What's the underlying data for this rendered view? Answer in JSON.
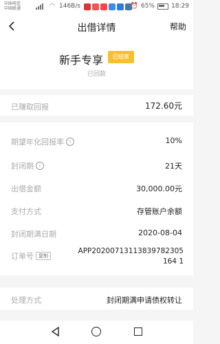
{
  "status_bar": {
    "carrier_line1": "中国电信",
    "carrier_line2": "中国联通",
    "net_speed": "146B/s",
    "battery": "65%",
    "time": "18:29"
  },
  "header": {
    "title": "出借详情",
    "help": "帮助"
  },
  "product": {
    "name": "新手专享",
    "tag": "已结束",
    "repay_status": "已回款"
  },
  "earned": {
    "label": "已赚取回报",
    "value": "172.60元"
  },
  "details": {
    "annual_rate_label": "期望年化回报率",
    "annual_rate_value": "10%",
    "lock_period_label": "封闭期",
    "lock_period_value": "21天",
    "amount_label": "出借金额",
    "amount_value": "30,000.00元",
    "payment_label": "支付方式",
    "payment_value": "存管账户余额",
    "due_date_label": "封闭期满日期",
    "due_date_value": "2020-08-04",
    "order_label": "订单号",
    "copy_label": "复制",
    "order_value": "APP20200713113839782305164 1"
  },
  "method": {
    "label": "处理方式",
    "value": "封闭期满申请债权转让"
  },
  "colors": {
    "tag_bg": "#f6c12d",
    "label": "#aaaaaa",
    "background": "#f5f5f5"
  }
}
